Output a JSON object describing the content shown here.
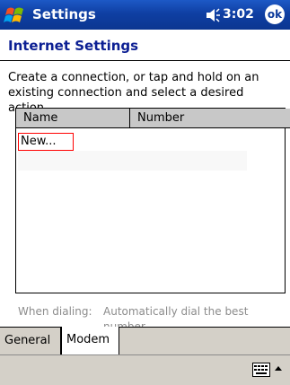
{
  "titlebar": {
    "title": "Settings",
    "time": "3:02",
    "ok_label": "ok"
  },
  "page": {
    "title": "Internet Settings",
    "instruction": "Create a connection, or tap and hold on an existing connection and select a desired action."
  },
  "list": {
    "columns": [
      "Name",
      "Number"
    ],
    "items": [
      "New..."
    ]
  },
  "dialing": {
    "label": "When dialing:",
    "value": "Automatically dial the best number"
  },
  "tabs": [
    "General",
    "Modem"
  ],
  "colors": {
    "titlebar": "#0b3691",
    "title_text": "#0c1f93",
    "selection_border": "#ff0000",
    "chrome": "#d4d0c8"
  }
}
